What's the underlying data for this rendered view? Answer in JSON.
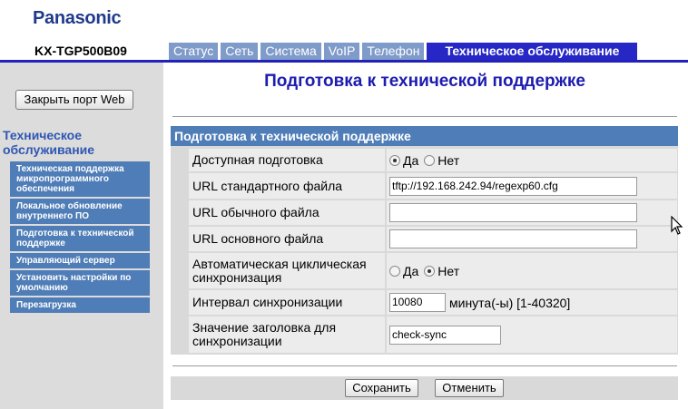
{
  "header": {
    "brand": "Panasonic",
    "model": "KX-TGP500B09",
    "tabs": [
      {
        "label": "Статус"
      },
      {
        "label": "Сеть"
      },
      {
        "label": "Система"
      },
      {
        "label": "VoIP"
      },
      {
        "label": "Телефон"
      },
      {
        "label": "Техническое обслуживание",
        "active": true
      }
    ]
  },
  "sidebar": {
    "close_port_label": "Закрыть порт Web",
    "section_title": "Техническое обслуживание",
    "items": [
      {
        "label": "Техническая поддержка микропрограммного обеспечения"
      },
      {
        "label": "Локальное обновление внутреннего ПО"
      },
      {
        "label": "Подготовка к технической поддержке"
      },
      {
        "label": "Управляющий сервер"
      },
      {
        "label": "Установить настройки по умолчанию"
      },
      {
        "label": "Перезагрузка"
      }
    ]
  },
  "main": {
    "title": "Подготовка к технической поддержке",
    "panel_title": "Подготовка к технической поддержке",
    "fields": {
      "provisioning": {
        "label": "Доступная подготовка",
        "yes": "Да",
        "no": "Нет",
        "selected": "yes"
      },
      "std_file_url": {
        "label": "URL стандартного файла",
        "value": "tftp://192.168.242.94/regexp60.cfg"
      },
      "product_file_url": {
        "label": "URL обычного файла",
        "value": ""
      },
      "master_file_url": {
        "label": "URL основного файла",
        "value": ""
      },
      "cyclic_resync": {
        "label": "Автоматическая циклическая синхронизация",
        "yes": "Да",
        "no": "Нет",
        "selected": "no"
      },
      "resync_interval": {
        "label": "Интервал синхронизации",
        "value": "10080",
        "unit": "минута(-ы) [1-40320]"
      },
      "header_value": {
        "label": "Значение заголовка для синхронизации",
        "value": "check-sync"
      }
    },
    "save_label": "Сохранить",
    "cancel_label": "Отменить"
  }
}
